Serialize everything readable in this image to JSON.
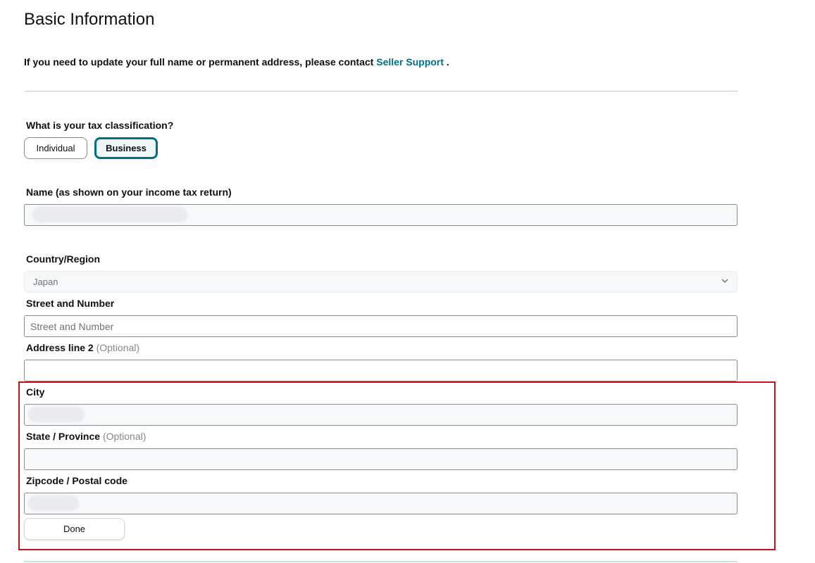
{
  "header": {
    "title": "Basic Information",
    "notice_text": "If you need to update your full name or permanent address, please contact ",
    "notice_link": "Seller Support",
    "notice_end": " ."
  },
  "tax_classification": {
    "question": "What is your tax classification?",
    "options": [
      "Individual",
      "Business"
    ],
    "selected": "Business"
  },
  "form": {
    "name_label": "Name (as shown on your income tax return)",
    "country_label": "Country/Region",
    "country_value": "Japan",
    "street_label": "Street and Number",
    "street_placeholder": "Street and Number",
    "address2_label": "Address line 2",
    "optional_text": "(Optional)",
    "city_label": "City",
    "state_label": "State / Province",
    "zip_label": "Zipcode / Postal code",
    "done_label": "Done"
  },
  "colors": {
    "accent": "#007185",
    "highlight": "#c7111e"
  }
}
